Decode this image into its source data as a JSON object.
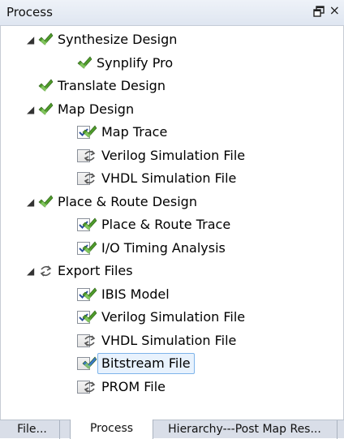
{
  "panel": {
    "title": "Process"
  },
  "tree": [
    {
      "label": "Synthesize Design",
      "level": 0,
      "expander": "expanded",
      "checkbox": null,
      "icon": "check"
    },
    {
      "label": "Synplify Pro",
      "level": 1,
      "expander": null,
      "checkbox": null,
      "icon": "check"
    },
    {
      "label": "Translate Design",
      "level": 0,
      "expander": null,
      "checkbox": null,
      "icon": "check"
    },
    {
      "label": "Map Design",
      "level": 0,
      "expander": "expanded",
      "checkbox": null,
      "icon": "check"
    },
    {
      "label": "Map Trace",
      "level": 1,
      "expander": null,
      "checkbox": true,
      "icon": "check"
    },
    {
      "label": "Verilog Simulation File",
      "level": 1,
      "expander": null,
      "checkbox": false,
      "icon": "refresh"
    },
    {
      "label": "VHDL Simulation File",
      "level": 1,
      "expander": null,
      "checkbox": false,
      "icon": "refresh"
    },
    {
      "label": "Place & Route Design",
      "level": 0,
      "expander": "expanded",
      "checkbox": null,
      "icon": "check"
    },
    {
      "label": "Place & Route Trace",
      "level": 1,
      "expander": null,
      "checkbox": true,
      "icon": "check"
    },
    {
      "label": "I/O Timing Analysis",
      "level": 1,
      "expander": null,
      "checkbox": true,
      "icon": "check"
    },
    {
      "label": "Export Files",
      "level": 0,
      "expander": "expanded",
      "checkbox": null,
      "icon": "refresh"
    },
    {
      "label": "IBIS Model",
      "level": 1,
      "expander": null,
      "checkbox": true,
      "icon": "check"
    },
    {
      "label": "Verilog Simulation File",
      "level": 1,
      "expander": null,
      "checkbox": true,
      "icon": "check"
    },
    {
      "label": "VHDL Simulation File",
      "level": 1,
      "expander": null,
      "checkbox": false,
      "icon": "refresh"
    },
    {
      "label": "Bitstream File",
      "level": 1,
      "expander": null,
      "checkbox": false,
      "icon": "check-blue",
      "selected": true
    },
    {
      "label": "PROM File",
      "level": 1,
      "expander": null,
      "checkbox": false,
      "icon": "refresh"
    }
  ],
  "tabs": [
    {
      "label": "File...",
      "active": false
    },
    {
      "label": "Process",
      "active": true
    },
    {
      "label": "Hierarchy---Post Map Res...",
      "active": false
    }
  ],
  "colors": {
    "check_green": "#4e9a2a",
    "check_blue": "#3a78c8",
    "selection_border": "#7eb4ea",
    "selection_fill": "#e8f2fd"
  }
}
